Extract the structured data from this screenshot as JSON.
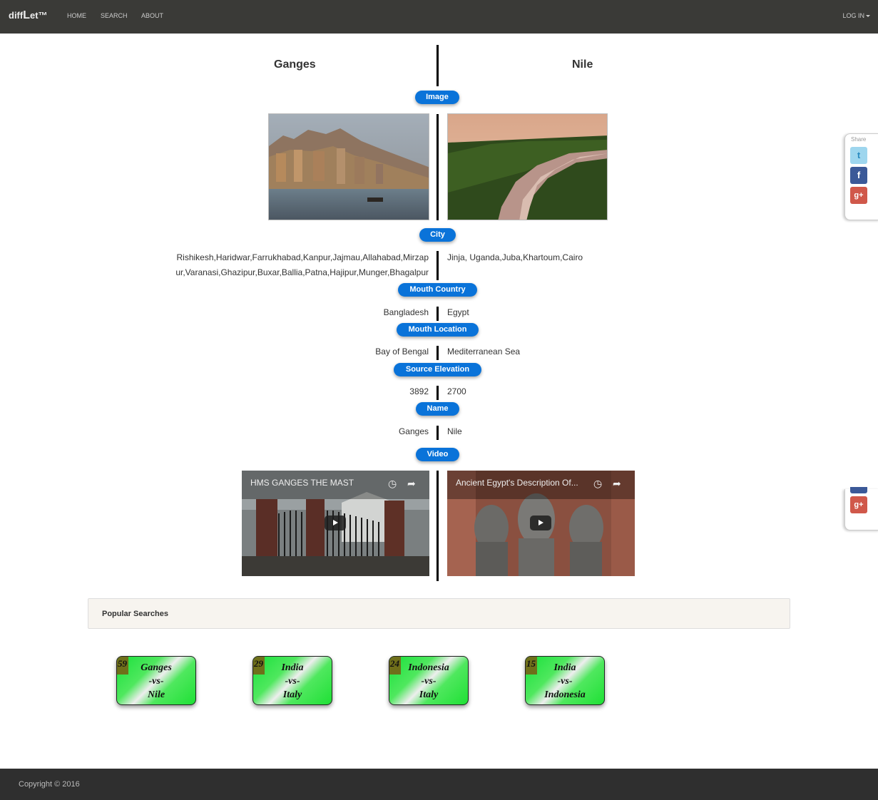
{
  "navbar": {
    "brand_prefix": "diff",
    "brand_big": "L",
    "brand_suffix": "et™",
    "links": [
      "HOME",
      "SEARCH",
      "ABOUT"
    ],
    "login": "LOG IN"
  },
  "compare": {
    "left_title": "Ganges",
    "right_title": "Nile",
    "sections": {
      "image": "Image",
      "city": "City",
      "mouth_country": "Mouth Country",
      "mouth_location": "Mouth Location",
      "source_elevation": "Source Elevation",
      "name": "Name",
      "video": "Video"
    },
    "city_left_line1": "Rishikesh,Haridwar,Farrukhabad,Kanpur,Jajmau,Allahabad,Mirzap",
    "city_left_line2": "ur,Varanasi,Ghazipur,Buxar,Ballia,Patna,Hajipur,Munger,Bhagalpur",
    "city_right": "Jinja, Uganda,Juba,Khartoum,Cairo",
    "mouth_country_left": "Bangladesh",
    "mouth_country_right": "Egypt",
    "mouth_location_left": "Bay of Bengal",
    "mouth_location_right": "Mediterranean Sea",
    "source_elevation_left": "3892",
    "source_elevation_right": "2700",
    "name_left": "Ganges",
    "name_right": "Nile",
    "video_left_title": "HMS GANGES THE MAST",
    "video_right_title": "Ancient Egypt's Description Of..."
  },
  "share": {
    "label": "Share",
    "icons": [
      "twitter-icon",
      "facebook-icon",
      "google-plus-icon"
    ]
  },
  "popular": {
    "heading": "Popular Searches",
    "cards": [
      {
        "count": "59",
        "left": "Ganges",
        "vs": "-vs-",
        "right": "Nile"
      },
      {
        "count": "29",
        "left": "India",
        "vs": "-vs-",
        "right": "Italy"
      },
      {
        "count": "24",
        "left": "Indonesia",
        "vs": "-vs-",
        "right": "Italy"
      },
      {
        "count": "15",
        "left": "India",
        "vs": "-vs-",
        "right": "Indonesia"
      }
    ]
  },
  "footer": {
    "copyright": "Copyright © 2016"
  },
  "colors": {
    "navbar": "#3a3a37",
    "pill": "#0a73d9",
    "card_green": "#18e03a",
    "footer": "#2f2f2f"
  }
}
